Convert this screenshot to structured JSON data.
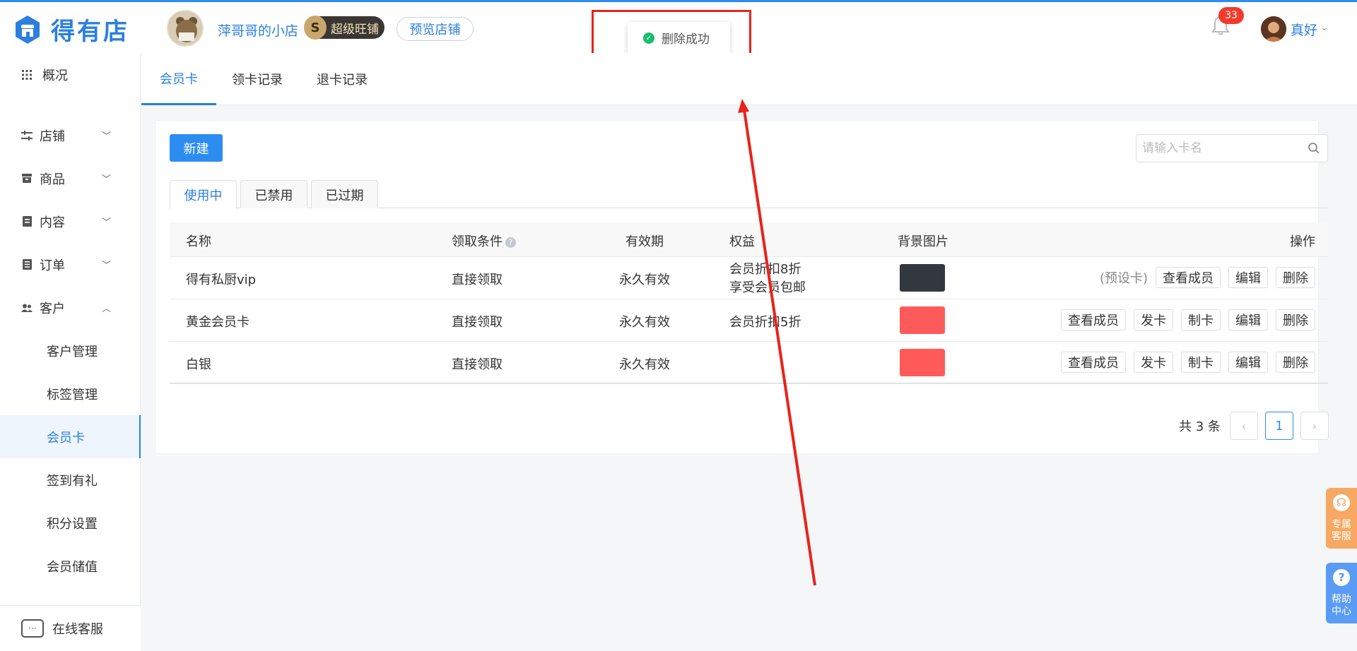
{
  "brand": {
    "name": "得有店"
  },
  "shop": {
    "name": "萍哥哥的小店",
    "level_letter": "S",
    "level_label": "超级旺铺",
    "preview_label": "预览店铺"
  },
  "notifications": {
    "count": "33"
  },
  "user": {
    "name": "真好"
  },
  "toast": {
    "message": "删除成功"
  },
  "sidebar": {
    "items": [
      {
        "label": "概况"
      },
      {
        "label": "店铺"
      },
      {
        "label": "商品"
      },
      {
        "label": "内容"
      },
      {
        "label": "订单"
      },
      {
        "label": "客户"
      }
    ],
    "sub_items": [
      {
        "label": "客户管理"
      },
      {
        "label": "标签管理"
      },
      {
        "label": "会员卡"
      },
      {
        "label": "签到有礼"
      },
      {
        "label": "积分设置"
      },
      {
        "label": "会员储值"
      }
    ],
    "online_service": "在线客服"
  },
  "top_tabs": [
    {
      "label": "会员卡"
    },
    {
      "label": "领卡记录"
    },
    {
      "label": "退卡记录"
    }
  ],
  "toolbar": {
    "new_label": "新建",
    "search_placeholder": "请输入卡名"
  },
  "card_tabs": [
    {
      "label": "使用中"
    },
    {
      "label": "已禁用"
    },
    {
      "label": "已过期"
    }
  ],
  "table": {
    "headers": {
      "name": "名称",
      "condition": "领取条件",
      "validity": "有效期",
      "benefits": "权益",
      "background": "背景图片",
      "actions": "操作"
    },
    "rows": [
      {
        "name": "得有私厨vip",
        "condition": "直接领取",
        "validity": "永久有效",
        "benefits_1": "会员折扣8折",
        "benefits_2": "享受会员包邮",
        "color": "#33383f",
        "note": "(预设卡)",
        "a1": "查看成员",
        "a2": "编辑",
        "a3": "删除"
      },
      {
        "name": "黄金会员卡",
        "condition": "直接领取",
        "validity": "永久有效",
        "benefits_1": "会员折扣5折",
        "color": "#ff5a5a",
        "a1": "查看成员",
        "a2": "发卡",
        "a3": "制卡",
        "a4": "编辑",
        "a5": "删除"
      },
      {
        "name": "白银",
        "condition": "直接领取",
        "validity": "永久有效",
        "benefits_1": "",
        "color": "#ff5a5a",
        "a1": "查看成员",
        "a2": "发卡",
        "a3": "制卡",
        "a4": "编辑",
        "a5": "删除"
      }
    ]
  },
  "pagination": {
    "total": "共 3 条",
    "current": "1"
  },
  "float": {
    "service": [
      "专属",
      "客服"
    ],
    "help": [
      "帮助",
      "中心"
    ]
  },
  "colors": {
    "accent": "#2d8cf0",
    "annotation": "#e8231a",
    "success": "#19be6b"
  }
}
